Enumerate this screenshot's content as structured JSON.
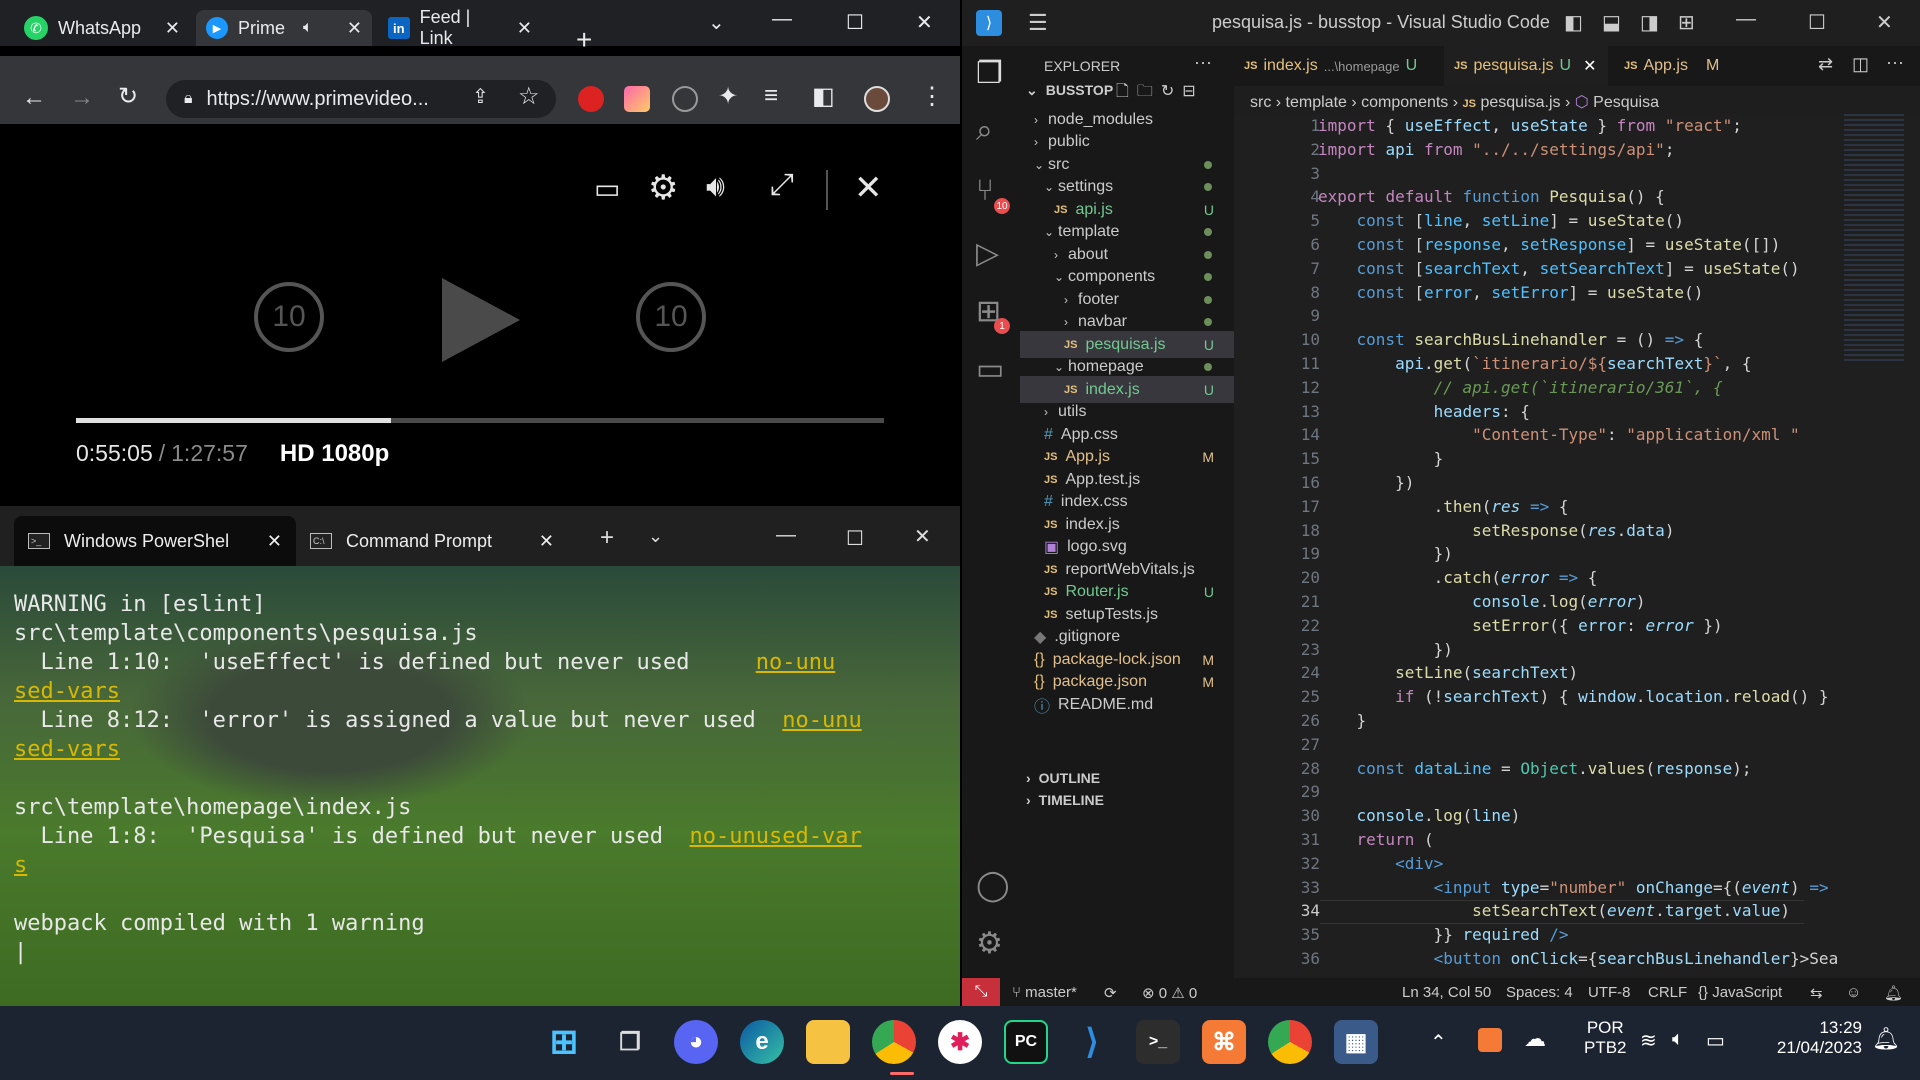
{
  "chrome": {
    "tabs": [
      {
        "label": "WhatsApp",
        "icon": "whatsapp-icon"
      },
      {
        "label": "Prime",
        "icon": "prime-video-icon"
      },
      {
        "label": "Feed | Link",
        "icon": "linkedin-icon"
      }
    ],
    "url": "https://www.primevideo..."
  },
  "player": {
    "current_time": "0:55:05",
    "separator": "/",
    "total_time": "1:27:57",
    "quality": "HD 1080p",
    "skip_back": "10",
    "skip_forward": "10",
    "progress": 0.39
  },
  "terminal": {
    "tabs": [
      {
        "label": "Windows PowerShel"
      },
      {
        "label": "Command Prompt"
      }
    ],
    "lines": {
      "l1": "WARNING in [eslint]",
      "l2": "src\\template\\components\\pesquisa.js",
      "l3": "  Line 1:10:  'useEffect' is defined but never used     ",
      "l3_link": "no-unu",
      "l4_link": "sed-vars",
      "l5": "  Line 8:12:  'error' is assigned a value but never used  ",
      "l5_link": "no-unu",
      "l6_link": "sed-vars",
      "l7": "src\\template\\homepage\\index.js",
      "l8": "  Line 1:8:  'Pesquisa' is defined but never used  ",
      "l8_link": "no-unused-var",
      "l9_link": "s",
      "l10": "webpack compiled with 1 warning",
      "cursor": "|"
    }
  },
  "vscode": {
    "title": "pesquisa.js - busstop - Visual Studio Code",
    "explorer_label": "EXPLORER",
    "project": "BUSSTOP",
    "outline": "OUTLINE",
    "timeline": "TIMELINE",
    "tree": [
      {
        "label": "node_modules"
      },
      {
        "label": "public"
      },
      {
        "label": "src"
      },
      {
        "label": "settings"
      },
      {
        "label": "api.js",
        "status": "U"
      },
      {
        "label": "template"
      },
      {
        "label": "about"
      },
      {
        "label": "components"
      },
      {
        "label": "footer"
      },
      {
        "label": "navbar"
      },
      {
        "label": "pesquisa.js",
        "status": "U"
      },
      {
        "label": "homepage"
      },
      {
        "label": "index.js",
        "status": "U"
      },
      {
        "label": "utils"
      },
      {
        "label": "App.css"
      },
      {
        "label": "App.js",
        "status": "M"
      },
      {
        "label": "App.test.js"
      },
      {
        "label": "index.css"
      },
      {
        "label": "index.js"
      },
      {
        "label": "logo.svg"
      },
      {
        "label": "reportWebVitals.js"
      },
      {
        "label": "Router.js",
        "status": "U"
      },
      {
        "label": "setupTests.js"
      },
      {
        "label": ".gitignore"
      },
      {
        "label": "package-lock.json",
        "status": "M"
      },
      {
        "label": "package.json",
        "status": "M"
      },
      {
        "label": "README.md"
      }
    ],
    "editor_tabs": [
      {
        "label": "index.js",
        "path": "...\\homepage",
        "status": "U"
      },
      {
        "label": "pesquisa.js",
        "status": "U"
      },
      {
        "label": "App.js",
        "status": "M"
      }
    ],
    "breadcrumbs": [
      "src",
      "template",
      "components",
      "pesquisa.js",
      "Pesquisa"
    ],
    "line_numbers": [
      "1",
      "2",
      "3",
      "4",
      "5",
      "6",
      "7",
      "8",
      "9",
      "10",
      "11",
      "12",
      "13",
      "14",
      "15",
      "16",
      "17",
      "18",
      "19",
      "20",
      "21",
      "22",
      "23",
      "24",
      "25",
      "26",
      "27",
      "28",
      "29",
      "30",
      "31",
      "32",
      "33",
      "34",
      "35",
      "36"
    ],
    "status": {
      "branch": "master*",
      "problems": "0",
      "warnings": "0",
      "position": "Ln 34, Col 50",
      "spaces": "Spaces: 4",
      "encoding": "UTF-8",
      "eol": "CRLF",
      "language": "JavaScript"
    },
    "badges": {
      "scm": "10",
      "extensions": "1"
    }
  },
  "taskbar": {
    "lang1": "POR",
    "lang2": "PTB2",
    "time": "13:29",
    "date": "21/04/2023"
  }
}
